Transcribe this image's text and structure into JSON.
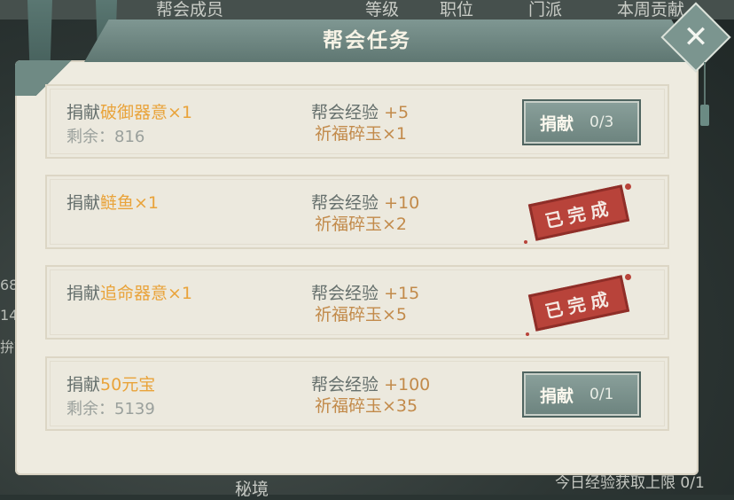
{
  "background": {
    "columns": [
      "帮会成员",
      "等级",
      "职位",
      "门派",
      "本周贡献"
    ],
    "side_fragments": [
      "68",
      "14",
      "拚市"
    ],
    "bottom_left": "秘境",
    "bottom_right": "今日经验获取上限 0/1"
  },
  "dialog": {
    "title": "帮会任务",
    "close_symbol": "✕"
  },
  "tasks": [
    {
      "prefix": "捐献",
      "item": "破御器意×1",
      "remain": "剩余：816",
      "reward_exp_label": "帮会经验",
      "reward_exp_value": "+5",
      "reward_item": "祈福碎玉×1",
      "status": "button",
      "button_label": "捐献",
      "button_count": "0/3"
    },
    {
      "prefix": "捐献",
      "item": "鲢鱼×1",
      "remain": "",
      "reward_exp_label": "帮会经验",
      "reward_exp_value": "+10",
      "reward_item": "祈福碎玉×2",
      "status": "done",
      "stamp_text": "已完成"
    },
    {
      "prefix": "捐献",
      "item": "追命器意×1",
      "remain": "",
      "reward_exp_label": "帮会经验",
      "reward_exp_value": "+15",
      "reward_item": "祈福碎玉×5",
      "status": "done",
      "stamp_text": "已完成"
    },
    {
      "prefix": "捐献",
      "item": "50元宝",
      "remain": "剩余：5139",
      "reward_exp_label": "帮会经验",
      "reward_exp_value": "+100",
      "reward_item": "祈福碎玉×35",
      "status": "button",
      "button_label": "捐献",
      "button_count": "0/1"
    }
  ],
  "colors": {
    "accent_item": "#e9a33a",
    "reward_text": "#c28a4a",
    "stamp_red": "#b8433a",
    "button_green": "#7b918c"
  }
}
